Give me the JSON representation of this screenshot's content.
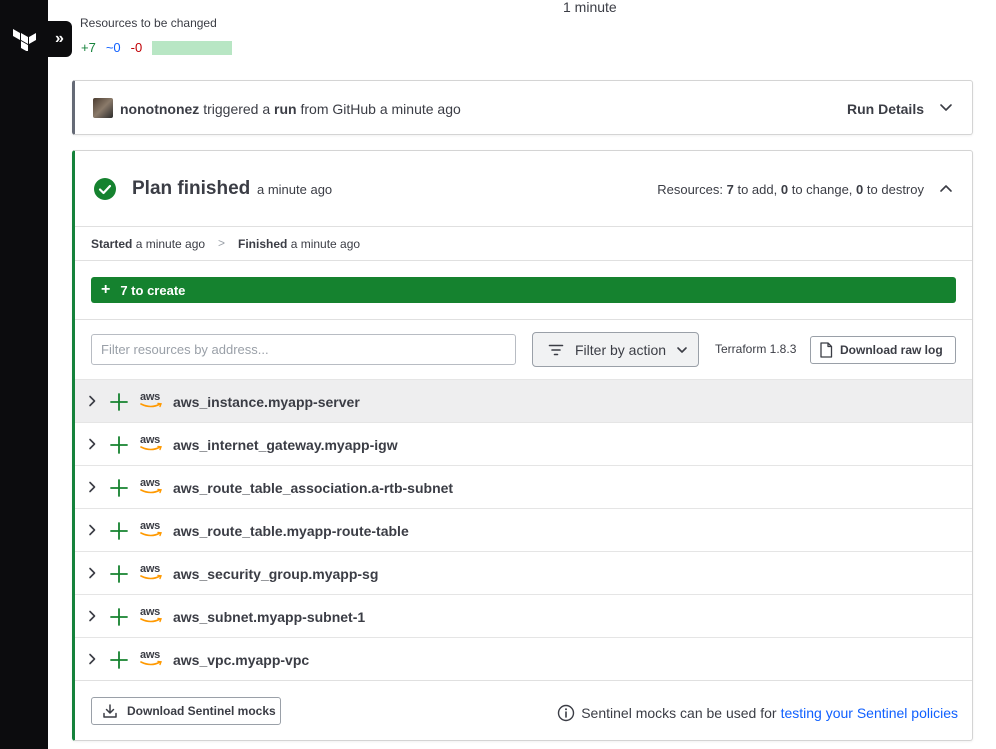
{
  "top": {
    "resources_label": "Resources to be changed",
    "add_count": "+7",
    "change_count": "~0",
    "destroy_count": "-0",
    "duration": "1 minute"
  },
  "trigger": {
    "user": "nonotnonez",
    "triggered_text": "triggered a",
    "run_word": "run",
    "source_text": "from GitHub a minute ago",
    "details_label": "Run Details"
  },
  "plan": {
    "title": "Plan finished",
    "ago": "a minute ago",
    "resources_label": "Resources:",
    "add_n": "7",
    "add_text": "to add,",
    "change_n": "0",
    "change_text": "to change,",
    "destroy_n": "0",
    "destroy_text": "to destroy",
    "started_label": "Started",
    "started_time": "a minute ago",
    "separator": ">",
    "finished_label": "Finished",
    "finished_time": "a minute ago",
    "create_label": "7 to create",
    "filter_placeholder": "Filter resources by address...",
    "filter_action_label": "Filter by action",
    "terraform_version": "Terraform 1.8.3",
    "download_log_label": "Download raw log",
    "provider_label": "aws",
    "resources": [
      "aws_instance.myapp-server",
      "aws_internet_gateway.myapp-igw",
      "aws_route_table_association.a-rtb-subnet",
      "aws_route_table.myapp-route-table",
      "aws_security_group.myapp-sg",
      "aws_subnet.myapp-subnet-1",
      "aws_vpc.myapp-vpc"
    ],
    "sentinel_button_label": "Download Sentinel mocks",
    "sentinel_note": "Sentinel mocks can be used for",
    "sentinel_link": "testing your Sentinel policies"
  },
  "colors": {
    "sidebar": "#0c0c0e",
    "success_green": "#15822f",
    "link_blue": "#1060ff",
    "aws_orange": "#ff9900"
  }
}
